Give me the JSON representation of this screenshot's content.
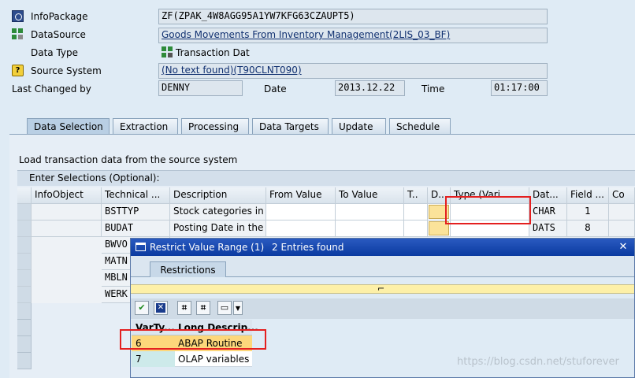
{
  "header": {
    "infopackage_label": "InfoPackage",
    "infopackage_value": "ZF(ZPAK_4W8AGG95A1YW7KFG63CZAUPT5)",
    "datasource_label": "DataSource",
    "datasource_value": "Goods Movements From Inventory Management(2LIS_03_BF)",
    "datatype_label": "Data Type",
    "datatype_value": "Transaction Dat",
    "sourcesystem_label": "Source System",
    "sourcesystem_value": "(No text found)(T90CLNT090)",
    "lastchanged_label": "Last Changed by",
    "lastchanged_value": "DENNY",
    "date_label": "Date",
    "date_value": "2013.12.22",
    "time_label": "Time",
    "time_value": "01:17:00"
  },
  "tabs": [
    "Data Selection",
    "Extraction",
    "Processing",
    "Data Targets",
    "Update",
    "Schedule"
  ],
  "panel": {
    "load_text": "Load transaction data from the source system",
    "selections_title": "Enter Selections (Optional):"
  },
  "grid": {
    "columns": [
      "InfoObject",
      "Technical ...",
      "Description",
      "From Value",
      "To Value",
      "T..",
      "D..",
      "Type (Vari...",
      "Dat...",
      "Field ...",
      "Co"
    ],
    "rows": [
      {
        "technical": "BSTTYP",
        "description": "Stock categories in ...",
        "datatype": "CHAR",
        "field": "1"
      },
      {
        "technical": "BUDAT",
        "description": "Posting Date in the ...",
        "datatype": "DATS",
        "field": "8"
      },
      {
        "technical": "BWVO",
        "description": "",
        "datatype": "",
        "field": ""
      },
      {
        "technical": "MATN",
        "description": "",
        "datatype": "",
        "field": ""
      },
      {
        "technical": "MBLN",
        "description": "",
        "datatype": "",
        "field": ""
      },
      {
        "technical": "WERK",
        "description": "",
        "datatype": "",
        "field": ""
      }
    ]
  },
  "dialog": {
    "title": "Restrict Value Range (1)",
    "subtitle": "2 Entries found",
    "tab": "Restrictions",
    "columns": [
      "VarTy...",
      "Long Descrip..."
    ],
    "rows": [
      {
        "code": "6",
        "desc": "ABAP Routine"
      },
      {
        "code": "7",
        "desc": "OLAP variables"
      }
    ]
  },
  "watermark": "https://blog.csdn.net/stuforever",
  "colors": {
    "dialog_title_bg": "#0a3aa0",
    "highlight_red": "#e41f1f",
    "selected_row": "#fdd77b",
    "yellow_field": "#fdf0a8"
  }
}
